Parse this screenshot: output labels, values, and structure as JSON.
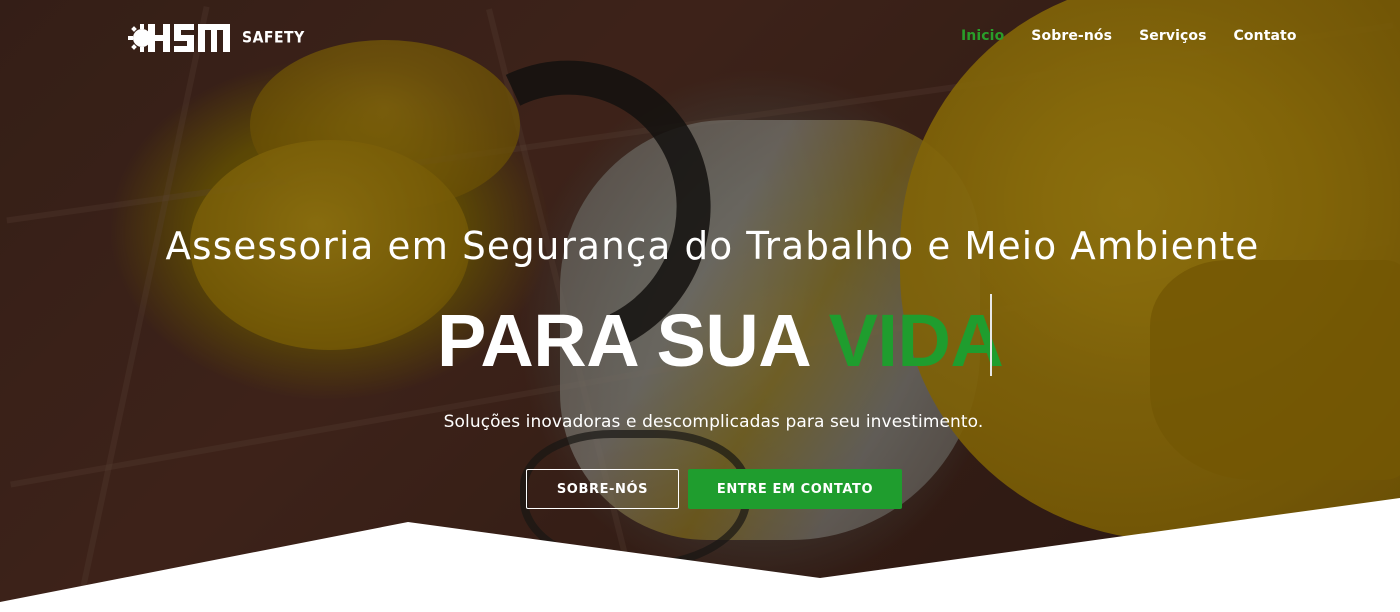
{
  "brand": {
    "logo_text": "SAFETY",
    "logo_icon": "hsm-gear-logo-icon"
  },
  "nav": {
    "items": [
      {
        "label": "Inicio",
        "active": true
      },
      {
        "label": "Sobre-nós",
        "active": false
      },
      {
        "label": "Serviços",
        "active": false
      },
      {
        "label": "Contato",
        "active": false
      }
    ]
  },
  "hero": {
    "headline": "Assessoria em Segurança do Trabalho e Meio Ambiente",
    "tagline_main": "PARA SUA ",
    "tagline_accent": "VIDA",
    "subtitle": "Soluções inovadoras e descomplicadas para seu investimento.",
    "buttons": {
      "about_label": "SOBRE-NÓS",
      "contact_label": "ENTRE EM CONTATO"
    }
  },
  "colors": {
    "accent_green": "#1f9d2e",
    "nav_active": "#2a9d2a",
    "text": "#ffffff"
  }
}
